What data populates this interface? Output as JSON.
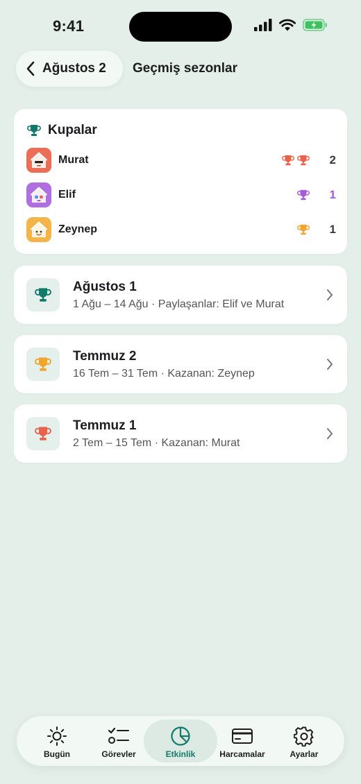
{
  "status_bar": {
    "time": "9:41"
  },
  "nav": {
    "back_label": "Ağustos 2",
    "title": "Geçmiş sezonlar"
  },
  "colors": {
    "accent": "#127a6a",
    "murat": "#e8634b",
    "elif": "#a55ad6",
    "zeynep": "#f0a52c"
  },
  "trophies": {
    "title": "Kupalar",
    "rows": [
      {
        "name": "Murat",
        "trophy_count": 2,
        "count_label": "2"
      },
      {
        "name": "Elif",
        "trophy_count": 1,
        "count_label": "1"
      },
      {
        "name": "Zeynep",
        "trophy_count": 1,
        "count_label": "1"
      }
    ]
  },
  "seasons": [
    {
      "title": "Ağustos 1",
      "subtitle": "1 Ağu – 14 Ağu · Paylaşanlar: Elif ve Murat",
      "trophy_color": "#127a6a"
    },
    {
      "title": "Temmuz 2",
      "subtitle": "16 Tem – 31 Tem · Kazanan: Zeynep",
      "trophy_color": "#f0a52c"
    },
    {
      "title": "Temmuz 1",
      "subtitle": "2 Tem – 15 Tem · Kazanan: Murat",
      "trophy_color": "#e8634b"
    }
  ],
  "tab_bar": {
    "active": "Etkinlik",
    "tabs": [
      {
        "label": "Bugün",
        "icon": "sun-icon"
      },
      {
        "label": "Görevler",
        "icon": "checklist-icon"
      },
      {
        "label": "Etkinlik",
        "icon": "pie-chart-icon"
      },
      {
        "label": "Harcamalar",
        "icon": "card-icon"
      },
      {
        "label": "Ayarlar",
        "icon": "gear-icon"
      }
    ]
  }
}
